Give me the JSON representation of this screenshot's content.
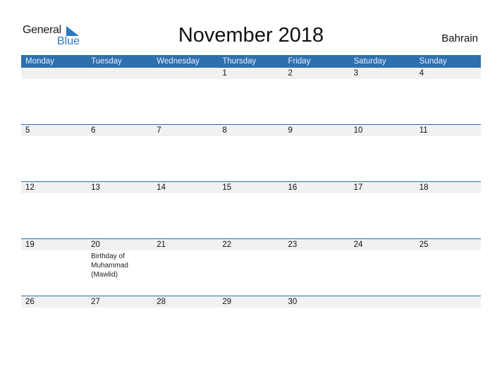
{
  "logo": {
    "line1": "General",
    "line2": "Blue"
  },
  "title": "November 2018",
  "country": "Bahrain",
  "colors": {
    "accent": "#2e6fb0",
    "date_row_bg": "#f1f1f1"
  },
  "weekdays": [
    "Monday",
    "Tuesday",
    "Wednesday",
    "Thursday",
    "Friday",
    "Saturday",
    "Sunday"
  ],
  "weeks": [
    {
      "days": [
        "",
        "",
        "",
        "1",
        "2",
        "3",
        "4"
      ],
      "events": [
        "",
        "",
        "",
        "",
        "",
        "",
        ""
      ]
    },
    {
      "days": [
        "5",
        "6",
        "7",
        "8",
        "9",
        "10",
        "11"
      ],
      "events": [
        "",
        "",
        "",
        "",
        "",
        "",
        ""
      ]
    },
    {
      "days": [
        "12",
        "13",
        "14",
        "15",
        "16",
        "17",
        "18"
      ],
      "events": [
        "",
        "",
        "",
        "",
        "",
        "",
        ""
      ]
    },
    {
      "days": [
        "19",
        "20",
        "21",
        "22",
        "23",
        "24",
        "25"
      ],
      "events": [
        "",
        "Birthday of Muhammad (Mawlid)",
        "",
        "",
        "",
        "",
        ""
      ]
    },
    {
      "days": [
        "26",
        "27",
        "28",
        "29",
        "30",
        "",
        ""
      ],
      "events": [
        "",
        "",
        "",
        "",
        "",
        "",
        ""
      ]
    }
  ]
}
